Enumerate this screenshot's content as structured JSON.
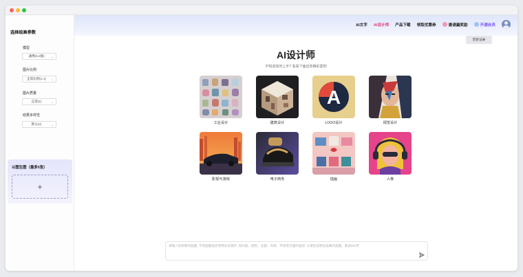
{
  "nav": {
    "items": [
      {
        "label": "AI文字",
        "active": false
      },
      {
        "label": "AI设计师",
        "active": true
      },
      {
        "label": "产品下载",
        "active": false
      },
      {
        "label": "领取优惠券",
        "active": false
      }
    ],
    "invite_label": "邀请赢奖励",
    "vip_label": "开通会员"
  },
  "sidebar": {
    "title": "选择绘画参数",
    "params": [
      {
        "label": "模型",
        "value": "通用(5.2版)"
      },
      {
        "label": "图片比例",
        "value": "正常比例(1:1)"
      },
      {
        "label": "图片质量",
        "value": "正常(1)"
      },
      {
        "label": "结果多样性",
        "value": "默认(2)"
      }
    ],
    "img2img": {
      "title": "以图生图（最多5张）",
      "upload_symbol": "+"
    }
  },
  "main": {
    "history_label": "历史记录",
    "title": "AI设计师",
    "subtitle": "不知道如何上手? 看看下面这些精彩案例",
    "categories": [
      {
        "label": "工业设计",
        "icon": "industrial-design-image"
      },
      {
        "label": "建筑设计",
        "icon": "architecture-design-image"
      },
      {
        "label": "LOGO设计",
        "icon": "logo-design-image"
      },
      {
        "label": "视觉设计",
        "icon": "visual-design-image"
      },
      {
        "label": "影视与游戏",
        "icon": "film-game-image"
      },
      {
        "label": "电子商务",
        "icon": "ecommerce-image"
      },
      {
        "label": "插画",
        "icon": "illustration-image"
      },
      {
        "label": "人像",
        "icon": "portrait-image"
      }
    ],
    "logo_letter": "A"
  },
  "prompt": {
    "placeholder": "请输入你想要的画面, 不同画面描述请用逗号隔开, 如内容、颜色、主题、风格、环境等方面的描述, 以便生成更加准确的画面。最多800字",
    "send_icon": "send-icon"
  },
  "colors": {
    "accent_pink": "#e23a7a",
    "vip_purple": "#7b57f0"
  }
}
